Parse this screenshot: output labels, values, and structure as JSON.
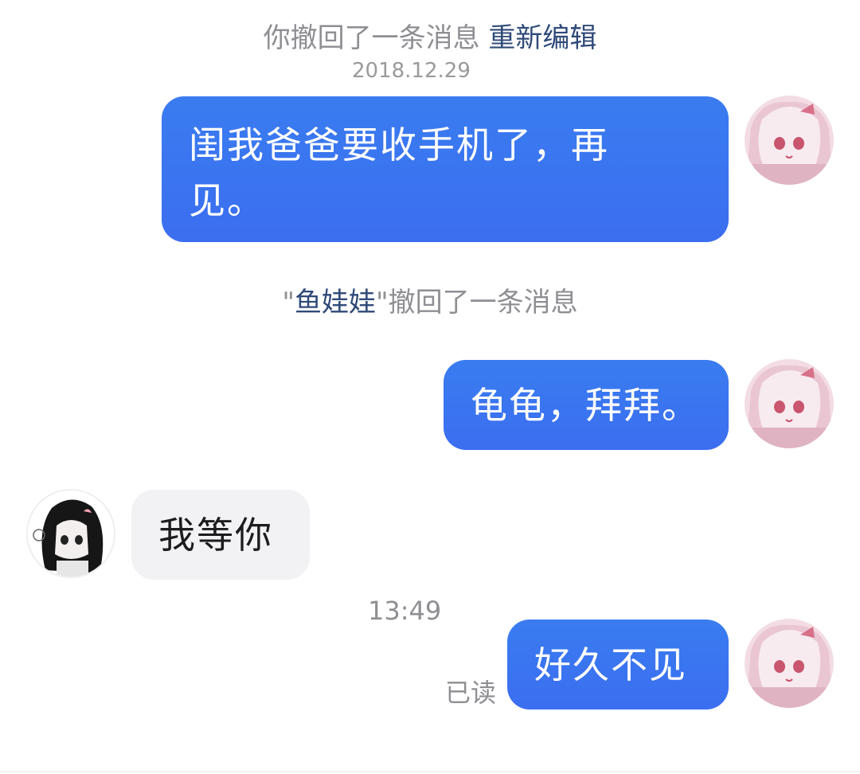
{
  "system": {
    "recall_self_text": "你撤回了一条消息",
    "recall_self_action": "重新编辑",
    "date_stamp": "2018.12.29",
    "recall_other_open_quote": "\"",
    "recall_other_name": "鱼娃娃",
    "recall_other_close_quote": "\"",
    "recall_other_text": "撤回了一条消息",
    "time_stamp": "13:49"
  },
  "messages": [
    {
      "direction": "outgoing",
      "line1": "闺我爸爸要收手机了，再",
      "line2": "见。"
    },
    {
      "direction": "outgoing",
      "text": "龟龟，拜拜。"
    },
    {
      "direction": "incoming",
      "text": "我等你"
    },
    {
      "direction": "outgoing",
      "text": "好久不见"
    }
  ],
  "read_receipt": "已读",
  "colors": {
    "outgoing_bubble": "#3b74f0",
    "incoming_bubble": "#f2f2f4",
    "system_text": "#8e8e93",
    "link_text": "#2f4a78"
  },
  "icons": {
    "self_avatar": "pink-anime-girl-avatar",
    "other_avatar": "black-hair-anime-girl-avatar"
  }
}
